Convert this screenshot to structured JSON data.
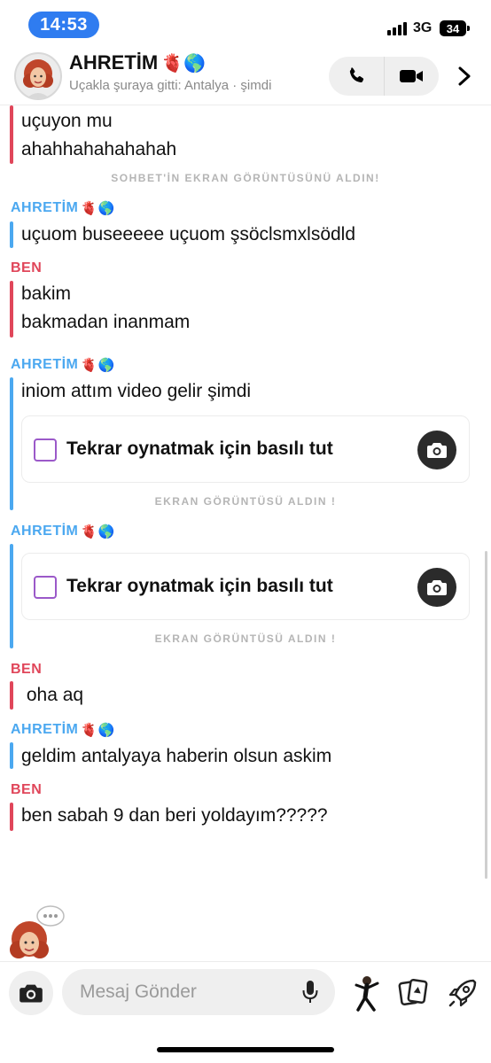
{
  "status_bar": {
    "time": "14:53",
    "network": "3G",
    "battery": "34"
  },
  "header": {
    "title": "AHRETİM",
    "title_emojis": "🫀🌎",
    "subtitle": "Uçakla şuraya gitti: Antalya · şimdi",
    "call_icon": "phone-icon",
    "video_icon": "video-camera-icon"
  },
  "chat": {
    "friend_name": "AHRETİM",
    "friend_emojis": "🫀🌎",
    "me_name": "BEN",
    "top_msg_1": "uçuyon mu",
    "top_msg_2": "ahahhahahahahah",
    "notice_1": "SOHBET'İN EKRAN GÖRÜNTÜSÜNÜ ALDIN!",
    "msg_2": "uçuom buseeeee uçuom şsöclsmxlsödld",
    "msg_3a": "bakim",
    "msg_3b": "bakmadan inanmam",
    "msg_4": "iniom attım video gelir şimdi",
    "snap_label": "Tekrar oynatmak için basılı tut",
    "notice_2": "EKRAN GÖRÜNTÜSÜ ALDIN !",
    "notice_3": "EKRAN GÖRÜNTÜSÜ ALDIN !",
    "msg_6": " oha aq",
    "msg_7": "geldim antalyaya haberin olsun askim",
    "msg_8": "ben sabah 9 dan beri yoldayım?????"
  },
  "composer": {
    "placeholder": "Mesaj Gönder"
  },
  "colors": {
    "friend": "#4ba8f0",
    "me": "#e0465a",
    "snap_check": "#9b59c9",
    "time_pill": "#2f7cf0"
  }
}
